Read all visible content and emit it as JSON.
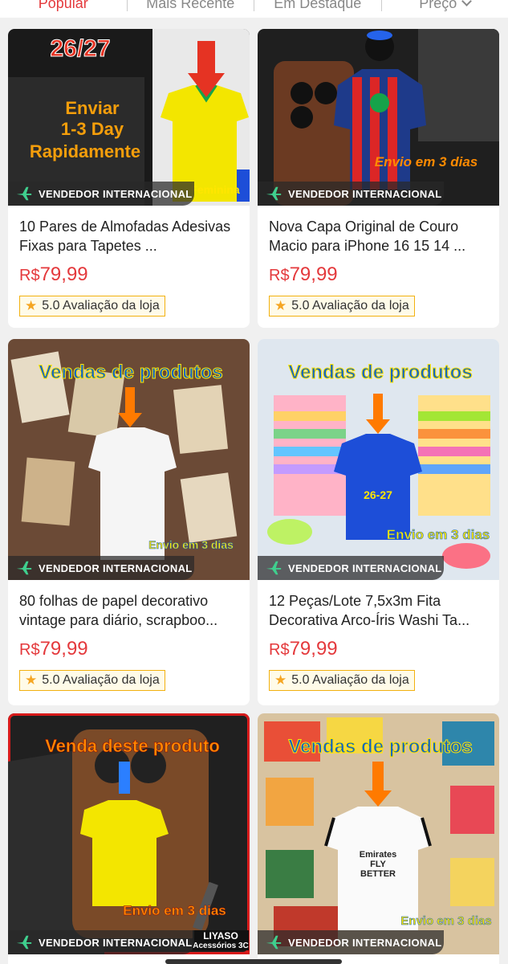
{
  "tabs": [
    {
      "label": "Popular",
      "active": true
    },
    {
      "label": "Mais Recente",
      "active": false
    },
    {
      "label": "Em Destaque",
      "active": false
    },
    {
      "label": "Preço",
      "active": false
    }
  ],
  "badge_label": "VENDEDOR INTERNACIONAL",
  "products": [
    {
      "title": "10 Pares de Almofadas Adesivas Fixas para Tapetes ...",
      "currency": "R$",
      "price": "79,99",
      "rating": "5.0 Avaliação da loja",
      "overlay": {
        "top": "26/27",
        "mid1": "Enviar",
        "mid2": "1-3 Day",
        "mid3": "Rapidamente",
        "corner": "Feminina"
      }
    },
    {
      "title": "Nova Capa Original de Couro Macio para iPhone 16 15 14 ...",
      "currency": "R$",
      "price": "79,99",
      "rating": "5.0 Avaliação da loja",
      "overlay": {
        "bottom": "Envio em 3 dias"
      }
    },
    {
      "title": "80 folhas de papel decorativo vintage para diário, scrapboo...",
      "currency": "R$",
      "price": "79,99",
      "rating": "5.0 Avaliação da loja",
      "overlay": {
        "top": "Vendas de produtos",
        "bottom": "Envio em 3 dias"
      }
    },
    {
      "title": "12 Peças/Lote 7,5x3m Fita Decorativa Arco-Íris Washi Ta...",
      "currency": "R$",
      "price": "79,99",
      "rating": "5.0 Avaliação da loja",
      "overlay": {
        "top": "Vendas de produtos",
        "mid": "26-27",
        "bottom": "Envio em 3 dias"
      }
    },
    {
      "title": "",
      "currency": "",
      "price": "",
      "rating": "",
      "overlay": {
        "top": "Venda deste produto",
        "bottom": "Envio em 3 dias",
        "brand1": "LIYASO",
        "brand2": "Acessórios 3C"
      }
    },
    {
      "title": "",
      "currency": "",
      "price": "",
      "rating": "",
      "overlay": {
        "top": "Vendas de produtos",
        "bottom": "Envio em 3 dias",
        "shirt": "Emirates FLY BETTER"
      }
    }
  ],
  "colors": {
    "accent": "#e4393c",
    "star": "#f5a623",
    "rating_border": "#f2b10f",
    "overlay_blue": "#1565c0",
    "overlay_yellow": "#ffe600",
    "overlay_orange": "#ff7a00"
  },
  "icons": {
    "plane": "airplane-icon",
    "star": "star-icon",
    "chevron": "chevron-down-icon"
  }
}
